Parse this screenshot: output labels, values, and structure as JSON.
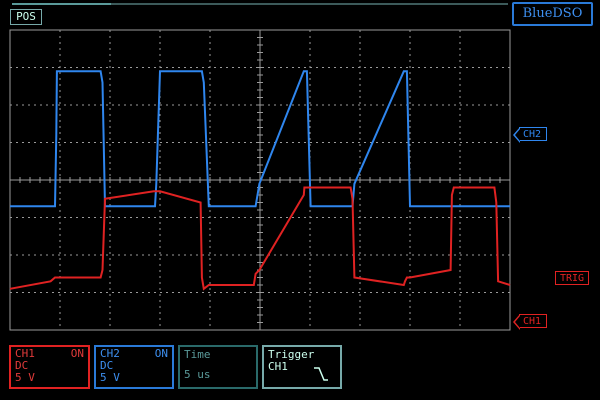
{
  "header": {
    "position_label": "POS",
    "brand": "BlueDSO",
    "position_progress": 0.2
  },
  "markers": {
    "ch2": "CH2",
    "ch1": "CH1",
    "trigger": "TRIG"
  },
  "panels": {
    "ch1": {
      "name": "CH1",
      "state": "ON",
      "coupling": "DC",
      "scale": "5 V"
    },
    "ch2": {
      "name": "CH2",
      "state": "ON",
      "coupling": "DC",
      "scale": "5 V"
    },
    "time": {
      "title": "Time",
      "value": "5 us"
    },
    "trigger": {
      "title": "Trigger",
      "source": "CH1",
      "slope_icon": "falling-edge-icon"
    }
  },
  "colors": {
    "ch1": "#e02222",
    "ch2": "#2f86ee",
    "grid": "#9a9a9a",
    "background": "#000000"
  },
  "chart_data": {
    "type": "line",
    "title": "",
    "xlabel": "",
    "ylabel": "",
    "x": [
      0,
      1.3,
      1.44,
      1.48,
      1.5,
      2.9,
      2.96,
      3.04,
      4.6,
      4.64,
      4.68,
      4.8,
      6.1,
      6.14,
      6.2,
      6.36,
      7.8,
      7.86,
      7.98,
      9.4,
      9.42,
      9.5,
      9.62,
      10.9,
      10.96,
      11.02,
      12.6,
      12.64,
      12.7,
      12.8,
      14.1,
      14.14,
      14.2,
      14.3,
      15.5,
      15.56,
      15.62,
      16.0
    ],
    "xlim": [
      0,
      16
    ],
    "ylim": [
      -4,
      4
    ],
    "series": [
      {
        "name": "CH2",
        "values": [
          -0.7,
          -0.7,
          -0.7,
          1.2,
          2.9,
          2.9,
          2.6,
          -0.7,
          -0.7,
          -0.7,
          -0.1,
          2.9,
          2.9,
          2.9,
          2.6,
          -0.7,
          -0.7,
          -0.7,
          -0.1,
          2.9,
          2.9,
          2.9,
          -0.7,
          -0.7,
          -0.7,
          -0.1,
          2.9,
          2.9,
          2.9,
          -0.7,
          -0.7,
          -0.7,
          -0.7,
          -0.7,
          -0.7,
          -0.7,
          -0.7,
          -0.7
        ]
      },
      {
        "name": "CH1",
        "values": [
          -2.9,
          -2.7,
          -2.6,
          -2.6,
          -2.6,
          -2.6,
          -2.4,
          -0.5,
          -0.3,
          -0.3,
          -0.3,
          -0.3,
          -0.6,
          -2.6,
          -2.9,
          -2.8,
          -2.8,
          -2.5,
          -2.4,
          -0.4,
          -0.2,
          -0.2,
          -0.2,
          -0.2,
          -0.5,
          -2.6,
          -2.8,
          -2.7,
          -2.6,
          -2.6,
          -2.4,
          -0.4,
          -0.2,
          -0.2,
          -0.2,
          -0.6,
          -2.7,
          -2.8
        ]
      }
    ]
  }
}
